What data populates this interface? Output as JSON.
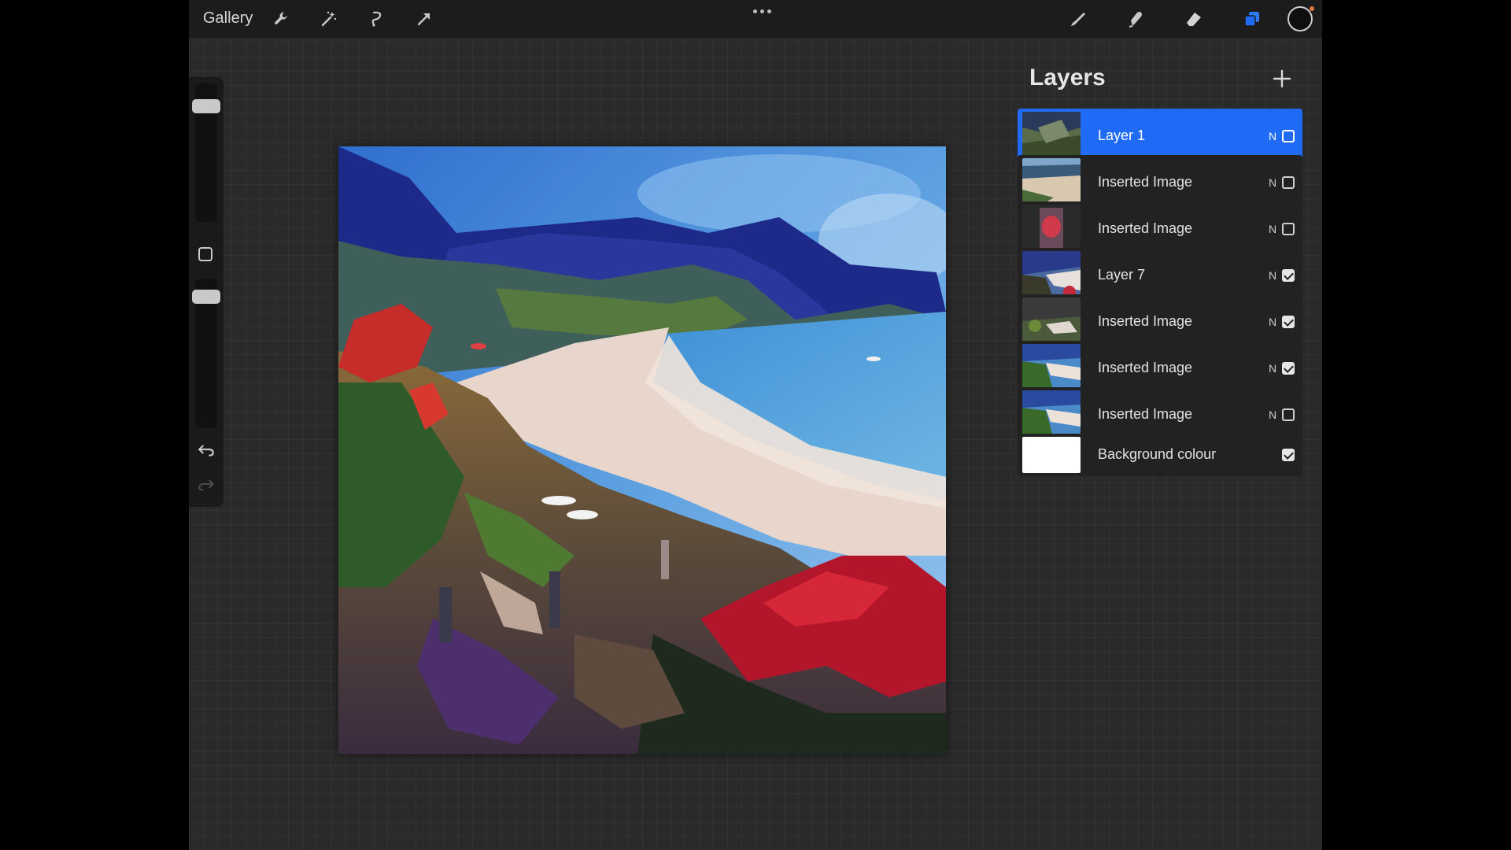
{
  "topbar": {
    "gallery_label": "Gallery",
    "icons": [
      "wrench-icon",
      "magic-wand-icon",
      "selection-icon",
      "transform-arrow-icon",
      "more-options-icon",
      "brush-icon",
      "smudge-icon",
      "eraser-icon",
      "layers-icon",
      "color-swatch-icon"
    ],
    "current_color": "#0f0f0f",
    "accent_color": "#1f6bf5"
  },
  "sidebar": {
    "brush_size_level": 0.85,
    "opacity_level": 0.9,
    "icons": [
      "modifier-square-icon",
      "undo-icon",
      "redo-icon"
    ]
  },
  "layers_panel": {
    "title": "Layers",
    "layers": [
      {
        "name": "Layer 1",
        "blend": "N",
        "visible": false,
        "selected": true,
        "thumb": "landscape-dark"
      },
      {
        "name": "Inserted Image",
        "blend": "N",
        "visible": false,
        "selected": false,
        "thumb": "beach-photo"
      },
      {
        "name": "Inserted Image",
        "blend": "N",
        "visible": false,
        "selected": false,
        "thumb": "red-flower-photo"
      },
      {
        "name": "Layer 7",
        "blend": "N",
        "visible": true,
        "selected": false,
        "thumb": "painting-blue"
      },
      {
        "name": "Inserted Image",
        "blend": "N",
        "visible": true,
        "selected": false,
        "thumb": "painting-green"
      },
      {
        "name": "Inserted Image",
        "blend": "N",
        "visible": true,
        "selected": false,
        "thumb": "painting-beach"
      },
      {
        "name": "Inserted Image",
        "blend": "N",
        "visible": false,
        "selected": false,
        "thumb": "painting-beach"
      },
      {
        "name": "Background colour",
        "blend": "",
        "visible": true,
        "selected": false,
        "thumb": "white"
      }
    ]
  }
}
